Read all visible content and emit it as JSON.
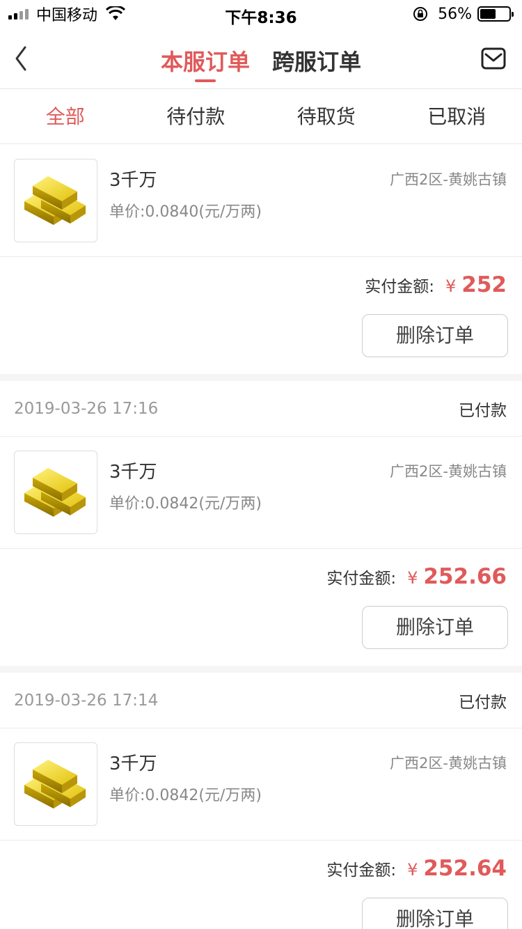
{
  "status_bar": {
    "carrier": "中国移动",
    "time": "下午8:36",
    "battery_percent": "56%",
    "battery_level": 0.56
  },
  "nav": {
    "tabs": [
      {
        "label": "本服订单",
        "active": true
      },
      {
        "label": "跨服订单",
        "active": false
      }
    ]
  },
  "filters": [
    {
      "label": "全部",
      "active": true
    },
    {
      "label": "待付款",
      "active": false
    },
    {
      "label": "待取货",
      "active": false
    },
    {
      "label": "已取消",
      "active": false
    }
  ],
  "orders": [
    {
      "item": {
        "name": "3千万",
        "unit_price": "单价:0.0840(元/万两)",
        "server": "广西2区-黄姚古镇"
      },
      "paid_label": "实付金额:",
      "currency": "¥",
      "amount": "252",
      "delete_label": "删除订单"
    },
    {
      "date": "2019-03-26 17:16",
      "status": "已付款",
      "item": {
        "name": "3千万",
        "unit_price": "单价:0.0842(元/万两)",
        "server": "广西2区-黄姚古镇"
      },
      "paid_label": "实付金额:",
      "currency": "¥",
      "amount": "252.66",
      "delete_label": "删除订单"
    },
    {
      "date": "2019-03-26 17:14",
      "status": "已付款",
      "item": {
        "name": "3千万",
        "unit_price": "单价:0.0842(元/万两)",
        "server": "广西2区-黄姚古镇"
      },
      "paid_label": "实付金额:",
      "currency": "¥",
      "amount": "252.64",
      "delete_label": "删除订单"
    }
  ],
  "colors": {
    "accent": "#e05a5a",
    "gold": "#e8c21a"
  }
}
